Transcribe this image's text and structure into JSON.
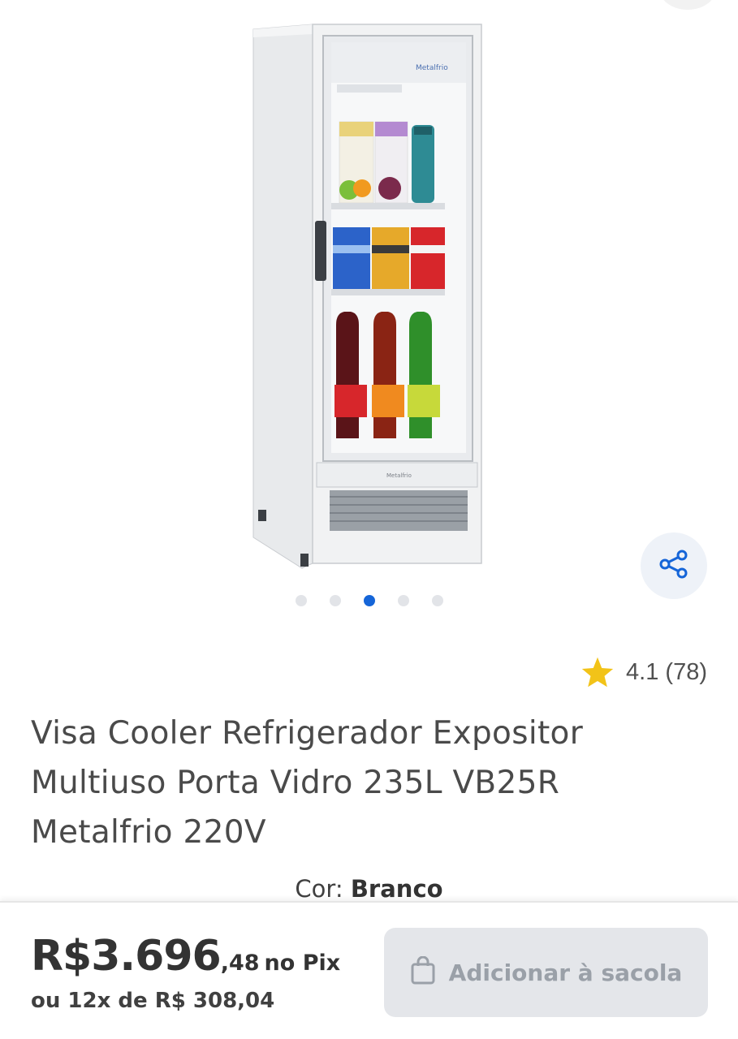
{
  "gallery": {
    "image_alt": "Visa Cooler Metalfrio",
    "fridge_brand": "Metalfrio",
    "dots_count": 5,
    "active_dot": 2
  },
  "rating": {
    "value": "4.1",
    "count": "(78)",
    "star_color": "#f2c318"
  },
  "product": {
    "title_line1": "Visa Cooler Refrigerador Expositor",
    "title_line2": "Multiuso Porta Vidro 235L VB25R",
    "title_line3": "Metalfrio 220V",
    "color_label": "Cor:",
    "color_value": "Branco"
  },
  "purchase": {
    "price_main": "R$3.696",
    "price_cents": ",48",
    "price_suffix": "no Pix",
    "installments": "ou 12x de R$ 308,04",
    "add_button_label": "Adicionar à sacola"
  },
  "icons": {
    "share": "share-icon",
    "star": "star-icon",
    "bag": "shopping-bag-icon"
  },
  "colors": {
    "accent": "#1565d8",
    "share_bg": "#eef2f8",
    "button_bg": "#e4e6ea"
  }
}
